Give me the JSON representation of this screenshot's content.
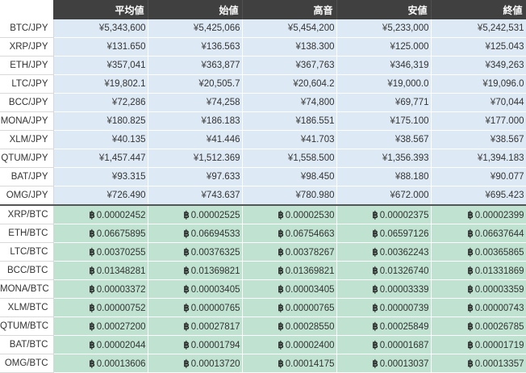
{
  "table": {
    "headers": [
      "平均値",
      "始値",
      "高音",
      "安値",
      "終値"
    ],
    "jpy_symbol": "¥",
    "btc_symbol": "฿",
    "jpy_rows": [
      {
        "pair": "BTC/JPY",
        "values": [
          "5,343,600",
          "5,425,066",
          "5,454,200",
          "5,233,000",
          "5,242,531"
        ]
      },
      {
        "pair": "XRP/JPY",
        "values": [
          "131.650",
          "136.563",
          "138.300",
          "125.000",
          "125.043"
        ]
      },
      {
        "pair": "ETH/JPY",
        "values": [
          "357,041",
          "363,877",
          "367,763",
          "346,319",
          "349,263"
        ]
      },
      {
        "pair": "LTC/JPY",
        "values": [
          "19,802.1",
          "20,505.7",
          "20,604.2",
          "19,000.0",
          "19,096.0"
        ]
      },
      {
        "pair": "BCC/JPY",
        "values": [
          "72,286",
          "74,258",
          "74,800",
          "69,771",
          "70,044"
        ]
      },
      {
        "pair": "MONA/JPY",
        "values": [
          "180.825",
          "186.183",
          "186.551",
          "175.100",
          "177.000"
        ]
      },
      {
        "pair": "XLM/JPY",
        "values": [
          "40.135",
          "41.446",
          "41.703",
          "38.567",
          "38.567"
        ]
      },
      {
        "pair": "QTUM/JPY",
        "values": [
          "1,457.447",
          "1,512.369",
          "1,558.500",
          "1,356.393",
          "1,394.183"
        ]
      },
      {
        "pair": "BAT/JPY",
        "values": [
          "93.315",
          "97.633",
          "98.450",
          "88.180",
          "90.077"
        ]
      },
      {
        "pair": "OMG/JPY",
        "values": [
          "726.490",
          "743.637",
          "780.980",
          "672.000",
          "695.423"
        ]
      }
    ],
    "btc_rows": [
      {
        "pair": "XRP/BTC",
        "values": [
          "0.00002452",
          "0.00002525",
          "0.00002530",
          "0.00002375",
          "0.00002399"
        ]
      },
      {
        "pair": "ETH/BTC",
        "values": [
          "0.06675895",
          "0.06694533",
          "0.06754663",
          "0.06597126",
          "0.06637644"
        ]
      },
      {
        "pair": "LTC/BTC",
        "values": [
          "0.00370255",
          "0.00376325",
          "0.00378267",
          "0.00362243",
          "0.00365865"
        ]
      },
      {
        "pair": "BCC/BTC",
        "values": [
          "0.01348281",
          "0.01369821",
          "0.01369821",
          "0.01326740",
          "0.01331869"
        ]
      },
      {
        "pair": "MONA/BTC",
        "values": [
          "0.00003372",
          "0.00003405",
          "0.00003405",
          "0.00003339",
          "0.00003359"
        ]
      },
      {
        "pair": "XLM/BTC",
        "values": [
          "0.00000752",
          "0.00000765",
          "0.00000765",
          "0.00000739",
          "0.00000743"
        ]
      },
      {
        "pair": "QTUM/BTC",
        "values": [
          "0.00027200",
          "0.00027817",
          "0.00028550",
          "0.00025849",
          "0.00026785"
        ]
      },
      {
        "pair": "BAT/BTC",
        "values": [
          "0.00002044",
          "0.00001794",
          "0.00002400",
          "0.00001687",
          "0.00001719"
        ]
      },
      {
        "pair": "OMG/BTC",
        "values": [
          "0.00013606",
          "0.00013720",
          "0.00014175",
          "0.00013037",
          "0.00013357"
        ]
      }
    ],
    "colors": {
      "header_bg": "#404040",
      "jpy_row_bg": "#dde9f4",
      "btc_row_bg": "#bfe2d1"
    }
  }
}
